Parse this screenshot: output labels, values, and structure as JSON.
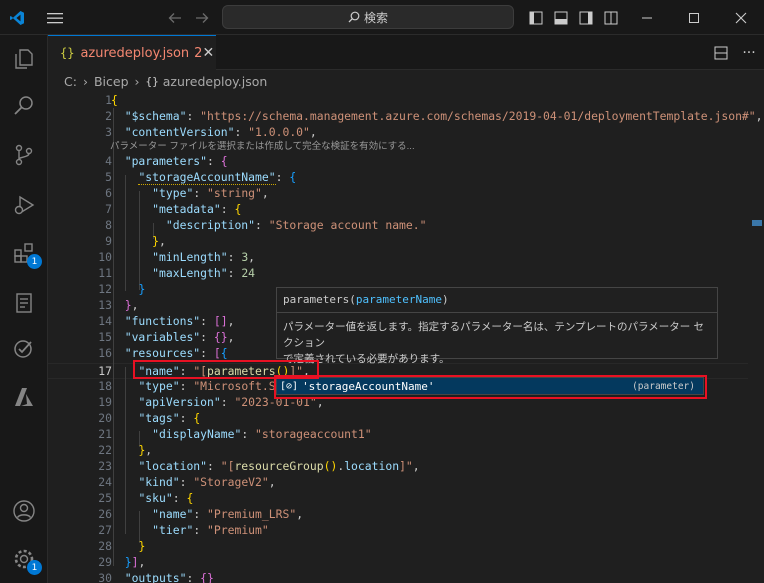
{
  "titlebar": {
    "search_label": "検索"
  },
  "activity": {
    "extensions_badge": "1",
    "settings_badge": "1"
  },
  "tab": {
    "filename": "azuredeploy.json",
    "problems": "2"
  },
  "breadcrumb": {
    "parts": [
      "C:",
      "Bicep",
      "azuredeploy.json"
    ]
  },
  "editor": {
    "line_numbers": [
      "1",
      "2",
      "3",
      "4",
      "5",
      "6",
      "7",
      "8",
      "9",
      "10",
      "11",
      "12",
      "13",
      "14",
      "15",
      "16",
      "17",
      "18",
      "19",
      "20",
      "21",
      "22",
      "23",
      "24",
      "25",
      "26",
      "27",
      "28",
      "29",
      "30"
    ],
    "codelens_hint": "パラメーター ファイルを選択または作成して完全な検証を有効にする...",
    "lines": {
      "l1": "{",
      "l2k": "\"$schema\"",
      "l2v": "\"https://schema.management.azure.com/schemas/2019-04-01/deploymentTemplate.json#\"",
      "l3k": "\"contentVersion\"",
      "l3v": "\"1.0.0.0\"",
      "l4k": "\"parameters\"",
      "l5k": "\"storageAccountName\"",
      "l6k": "\"type\"",
      "l6v": "\"string\"",
      "l7k": "\"metadata\"",
      "l8k": "\"description\"",
      "l8v": "\"Storage account name.\"",
      "l10k": "\"minLength\"",
      "l10v": "3",
      "l11k": "\"maxLength\"",
      "l11v": "24",
      "l14k": "\"functions\"",
      "l15k": "\"variables\"",
      "l16k": "\"resources\"",
      "l17k": "\"name\"",
      "l17a": "\"[",
      "l17f": "parameters",
      "l17b": "]\"",
      "l18k": "\"type\"",
      "l18v": "\"Microsoft.St",
      "l19k": "\"apiVersion\"",
      "l19v": "\"2023-01-01\"",
      "l20k": "\"tags\"",
      "l21k": "\"displayName\"",
      "l21v": "\"storageaccount1\"",
      "l23k": "\"location\"",
      "l23a": "\"[",
      "l23f1": "resourceGroup",
      "l23f2": "location",
      "l23b": "]\"",
      "l24k": "\"kind\"",
      "l24v": "\"StorageV2\"",
      "l25k": "\"sku\"",
      "l26k": "\"name\"",
      "l26v": "\"Premium_LRS\"",
      "l27k": "\"tier\"",
      "l27v": "\"Premium\"",
      "l30k": "\"outputs\""
    }
  },
  "hover": {
    "func": "parameters",
    "param": "parameterName",
    "doc_line1": "パラメーター値を返します。指定するパラメーター名は、テンプレートのパラメーター セクション",
    "doc_line2": "で定義されている必要があります。"
  },
  "suggestion": {
    "label": "'storageAccountName'",
    "kind": "(parameter)"
  },
  "colors": {
    "accent": "#0078d4",
    "highlight_box": "#e81123",
    "tab_error": "#f48771"
  }
}
